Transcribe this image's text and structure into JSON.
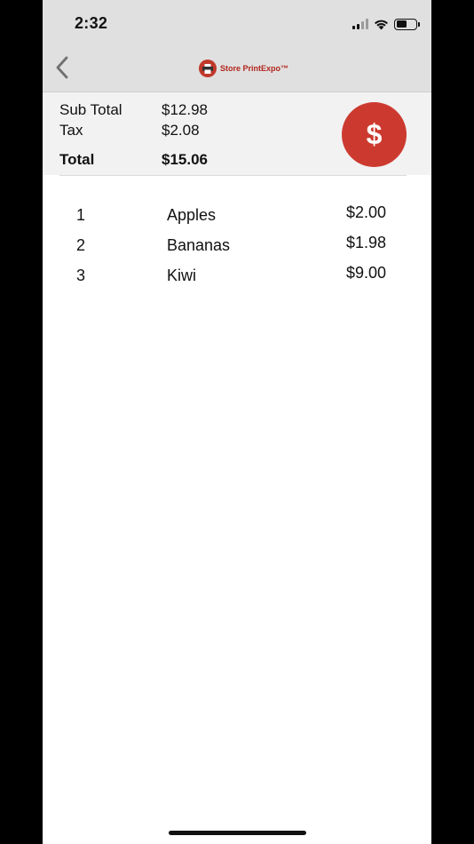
{
  "status_bar": {
    "time": "2:32"
  },
  "nav": {
    "logo_text": "Store PrintExpo™"
  },
  "summary": {
    "subtotal_label": "Sub Total",
    "subtotal_value": "$12.98",
    "tax_label": "Tax",
    "tax_value": "$2.08",
    "total_label": "Total",
    "total_value": "$15.06"
  },
  "pay_button": {
    "symbol": "$"
  },
  "items": [
    {
      "num": "1",
      "name": "Apples",
      "price": "$2.00"
    },
    {
      "num": "2",
      "name": "Bananas",
      "price": "$1.98"
    },
    {
      "num": "3",
      "name": "Kiwi",
      "price": "$9.00"
    }
  ],
  "colors": {
    "accent": "#cc3a2f",
    "header_bg": "#e0e0e0",
    "summary_bg": "#f2f2f2"
  },
  "icons": {
    "back": "chevron-left-icon",
    "signal": "cellular-signal-icon",
    "wifi": "wifi-icon",
    "battery": "battery-icon",
    "logo": "printer-logo-icon"
  }
}
